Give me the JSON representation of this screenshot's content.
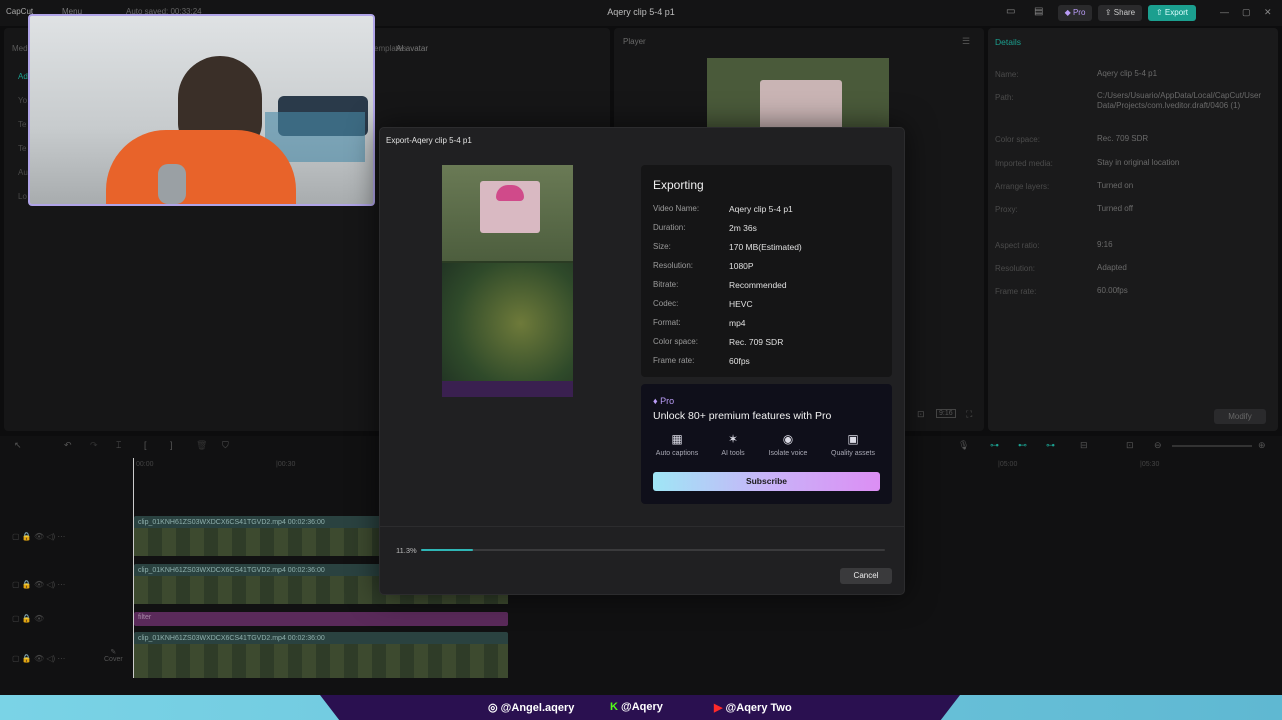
{
  "app": {
    "logo_label": "CapCut",
    "menu_label": "Menu",
    "autosave_text": "Auto saved: 00:33:24",
    "window_title": "Aqery clip 5-4 p1",
    "pro_label": "Pro",
    "share_label": "Share",
    "export_label": "Export"
  },
  "left_panel": {
    "tabs": [
      "Media",
      "Templates",
      "AI avatar"
    ],
    "side_items": [
      "Ad",
      "Yo",
      "Te",
      "Te",
      "Au",
      "Lo"
    ]
  },
  "player": {
    "label": "Player"
  },
  "details": {
    "header": "Details",
    "rows": [
      {
        "label": "Name:",
        "value": "Aqery clip 5-4 p1"
      },
      {
        "label": "Path:",
        "value": "C:/Users/Usuario/AppData/Local/CapCut/User Data/Projects/com.lveditor.draft/0406 (1)"
      },
      {
        "label": "Color space:",
        "value": "Rec. 709 SDR"
      },
      {
        "label": "Imported media:",
        "value": "Stay in original location"
      },
      {
        "label": "Arrange layers:",
        "value": "Turned on"
      },
      {
        "label": "Proxy:",
        "value": "Turned off"
      },
      {
        "label": "Aspect ratio:",
        "value": "9:16"
      },
      {
        "label": "Resolution:",
        "value": "Adapted"
      },
      {
        "label": "Frame rate:",
        "value": "60.00fps"
      }
    ],
    "modify_label": "Modify"
  },
  "timeline": {
    "times": [
      "00:00",
      "|00:30",
      "|05:00",
      "|05:30"
    ],
    "clips": [
      {
        "name": "clip_01KNH61ZS03WXDCX6CS41TGVD2.mp4",
        "duration": "00:02:36:00"
      },
      {
        "name": "clip_01KNH61ZS03WXDCX6CS41TGVD2.mp4",
        "duration": "00:02:36:00"
      },
      {
        "name": "filter",
        "duration": ""
      },
      {
        "name": "clip_01KNH61ZS03WXDCX6CS41TGVD2.mp4",
        "duration": "00:02:36:00"
      }
    ],
    "cover_label": "Cover"
  },
  "export_dialog": {
    "title": "Export-Aqery clip 5-4 p1",
    "heading": "Exporting",
    "rows": [
      {
        "label": "Video Name:",
        "value": "Aqery clip 5-4 p1"
      },
      {
        "label": "Duration:",
        "value": "2m 36s"
      },
      {
        "label": "Size:",
        "value": "170 MB(Estimated)"
      },
      {
        "label": "Resolution:",
        "value": "1080P"
      },
      {
        "label": "Bitrate:",
        "value": "Recommended"
      },
      {
        "label": "Codec:",
        "value": "HEVC"
      },
      {
        "label": "Format:",
        "value": "mp4"
      },
      {
        "label": "Color space:",
        "value": "Rec. 709 SDR"
      },
      {
        "label": "Frame rate:",
        "value": "60fps"
      }
    ],
    "pro_badge": "Pro",
    "pro_headline": "Unlock 80+ premium features with Pro",
    "features": [
      {
        "icon": "grid-icon",
        "label": "Auto captions"
      },
      {
        "icon": "wand-icon",
        "label": "AI tools"
      },
      {
        "icon": "voice-icon",
        "label": "Isolate voice"
      },
      {
        "icon": "image-icon",
        "label": "Quality assets"
      }
    ],
    "subscribe_label": "Subscribe",
    "progress_text": "11.3%",
    "progress": 0.113,
    "cancel_label": "Cancel"
  },
  "banner": {
    "instagram": "@Angel.aqery",
    "kick": "@Aqery",
    "youtube": "@Aqery Two",
    "colors": {
      "accent": "#7ad3e6",
      "center": "#2a1050"
    }
  },
  "colors": {
    "export_button": "#1b9f8f",
    "progress_fill": "#2fb6b6",
    "pro_accent": "#b99cf6"
  }
}
